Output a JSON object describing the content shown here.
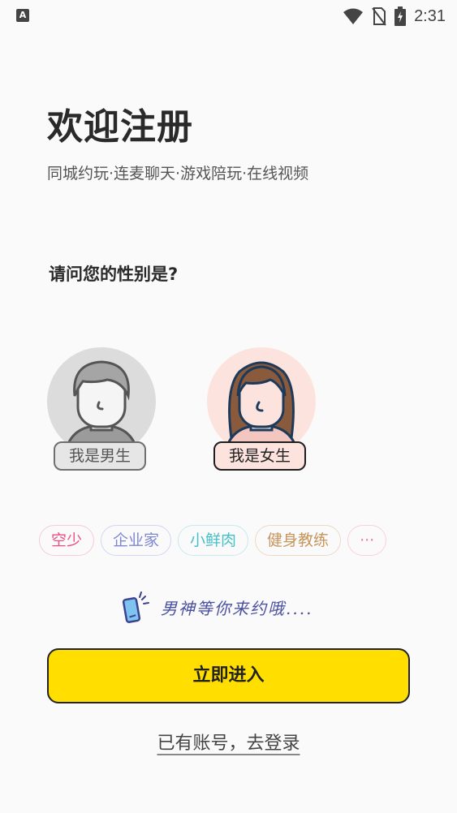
{
  "status_bar": {
    "app_icon_letter": "A",
    "time": "2:31",
    "icons": [
      "wifi-icon",
      "no-sim-icon",
      "battery-charging-icon"
    ]
  },
  "header": {
    "title": "欢迎注册",
    "subtitle": "同城约玩·连麦聊天·游戏陪玩·在线视频"
  },
  "gender": {
    "question": "请问您的性别是?",
    "options": [
      {
        "label": "我是男生",
        "icon": "male-avatar-icon"
      },
      {
        "label": "我是女生",
        "icon": "female-avatar-icon"
      }
    ]
  },
  "tags": [
    "空少",
    "企业家",
    "小鲜肉",
    "健身教练",
    "···"
  ],
  "slogan": {
    "icon": "phone-icon",
    "text": "男神等你来约哦...."
  },
  "actions": {
    "enter_label": "立即进入",
    "login_label": "已有账号，去登录"
  },
  "colors": {
    "primary_button": "#ffde00",
    "tag_colors": [
      "#ef4d84",
      "#7d87d2",
      "#48c0c7",
      "#c7955d",
      "#ef7d8f"
    ],
    "slogan_text": "#4a4fa0"
  }
}
